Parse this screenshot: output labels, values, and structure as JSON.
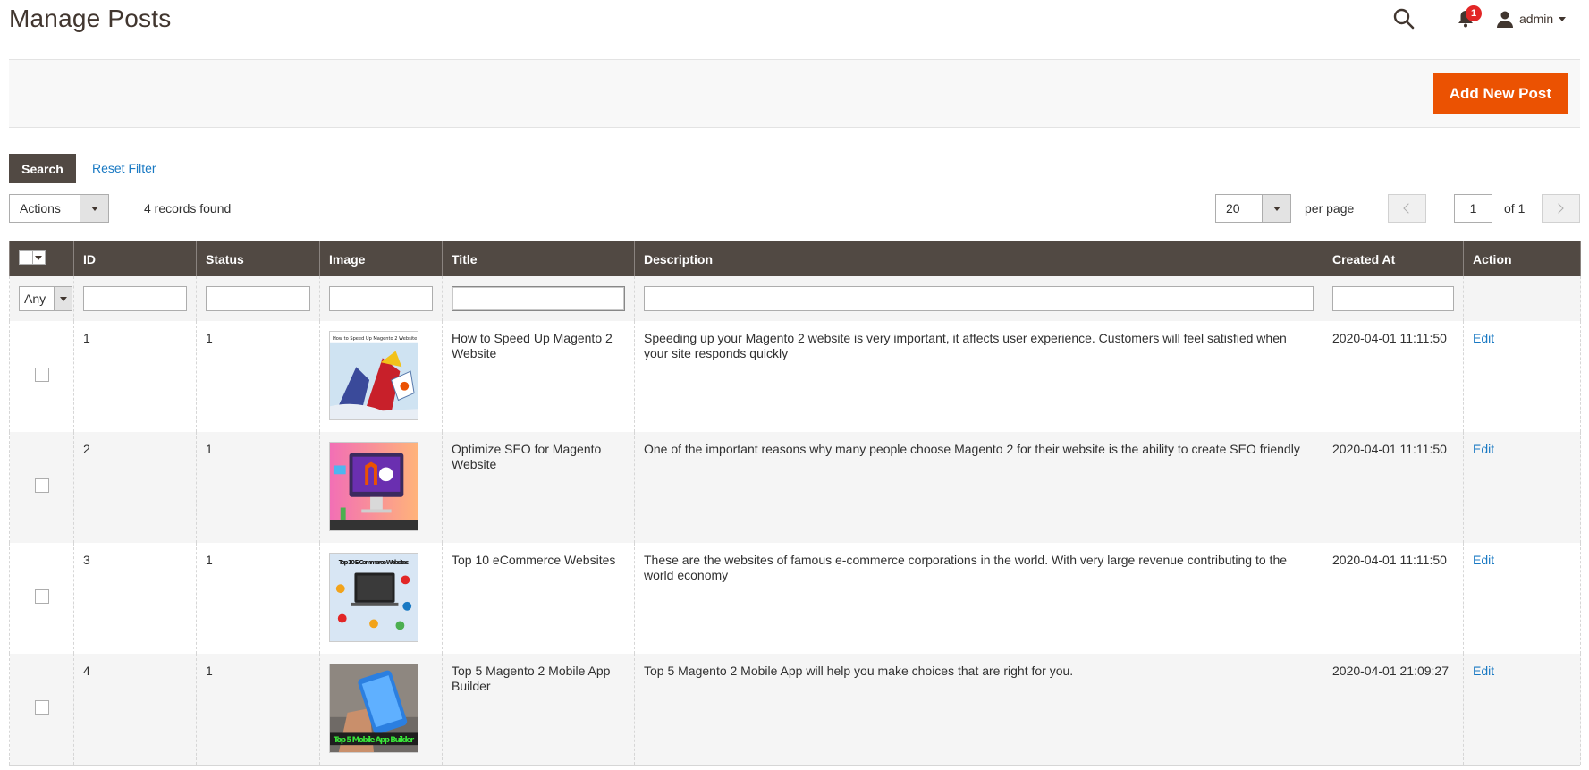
{
  "page": {
    "title": "Manage Posts"
  },
  "header": {
    "notification_count": "1",
    "user_name": "admin"
  },
  "toolbar": {
    "add_label": "Add New Post"
  },
  "filters": {
    "search_label": "Search",
    "reset_label": "Reset Filter",
    "actions_label": "Actions",
    "records_found": "4 records found",
    "per_page_value": "20",
    "per_page_label": "per page",
    "page_number": "1",
    "page_of": "of 1",
    "status_any": "Any"
  },
  "table": {
    "columns": [
      "ID",
      "Status",
      "Image",
      "Title",
      "Description",
      "Created At",
      "Action"
    ],
    "rows": [
      {
        "id": "1",
        "status": "1",
        "title": "How to Speed Up Magento 2 Website",
        "description": "Speeding up your Magento 2 website is very important, it affects user experience. Customers will feel satisfied when your site responds quickly",
        "created_at": "2020-04-01 11:11:50",
        "action": "Edit",
        "image_caption": "How to Speed Up Magento 2 Website"
      },
      {
        "id": "2",
        "status": "1",
        "title": "Optimize SEO for Magento Website",
        "description": "One of the important reasons why many people choose Magento 2 for their website is the ability to create SEO friendly",
        "created_at": "2020-04-01 11:11:50",
        "action": "Edit",
        "image_caption": ""
      },
      {
        "id": "3",
        "status": "1",
        "title": "Top 10 eCommerce Websites",
        "description": "These are the websites of famous e-commerce corporations in the world. With very large revenue contributing to the world economy",
        "created_at": "2020-04-01 11:11:50",
        "action": "Edit",
        "image_caption": "Top 10 E-Commerce Websites"
      },
      {
        "id": "4",
        "status": "1",
        "title": "Top 5 Magento 2 Mobile App Builder",
        "description": "Top 5 Magento 2 Mobile App will help you make choices that are right for you.",
        "created_at": "2020-04-01 21:09:27",
        "action": "Edit",
        "image_caption": "Top 5 Mobile App Builder"
      }
    ]
  },
  "colors": {
    "accent": "#eb5202",
    "header_dark": "#514943",
    "link": "#1979c3",
    "badge": "#e22626"
  },
  "icons": [
    "search-icon",
    "bell-icon",
    "user-icon",
    "chevron-down-icon",
    "chevron-left-icon",
    "chevron-right-icon"
  ]
}
